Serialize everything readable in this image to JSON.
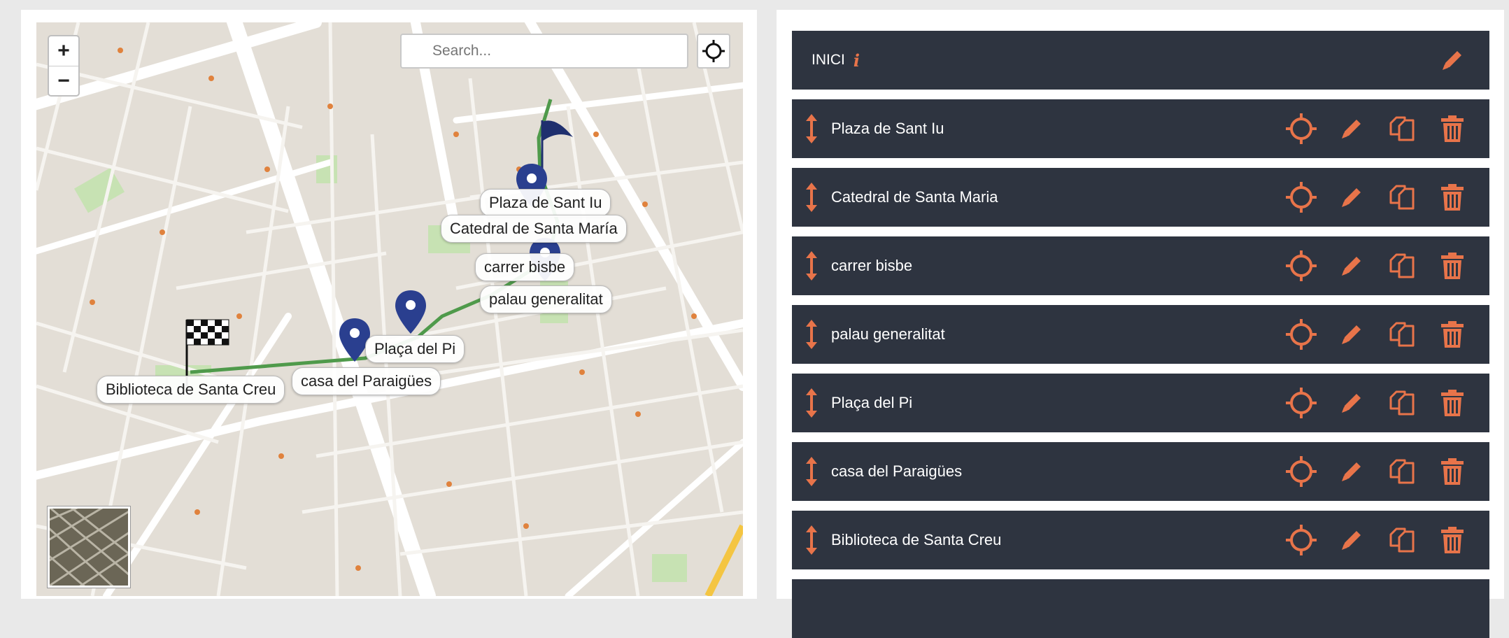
{
  "map": {
    "zoom_in": "+",
    "zoom_out": "−",
    "search_placeholder": "Search...",
    "labels": {
      "plaza_sant_iu": "Plaza de Sant Iu",
      "catedral": "Catedral de Santa María",
      "carrer_bisbe": "carrer bisbe",
      "palau": "palau generalitat",
      "placa_pi": "Plaça del Pi",
      "casa_paraigues": "casa del Paraigües",
      "biblioteca": "Biblioteca de Santa Creu"
    }
  },
  "list": {
    "header": {
      "title": "INICI"
    },
    "items": [
      {
        "title": "Plaza de Sant Iu"
      },
      {
        "title": "Catedral de Santa Maria"
      },
      {
        "title": "carrer bisbe"
      },
      {
        "title": "palau generalitat"
      },
      {
        "title": "Plaça del Pi"
      },
      {
        "title": "casa del Paraigües"
      },
      {
        "title": "Biblioteca de Santa Creu"
      }
    ]
  },
  "colors": {
    "accent": "#e8744a",
    "row_bg": "#2e3440",
    "route": "#4f9a4b",
    "marker": "#2a3f8f"
  }
}
